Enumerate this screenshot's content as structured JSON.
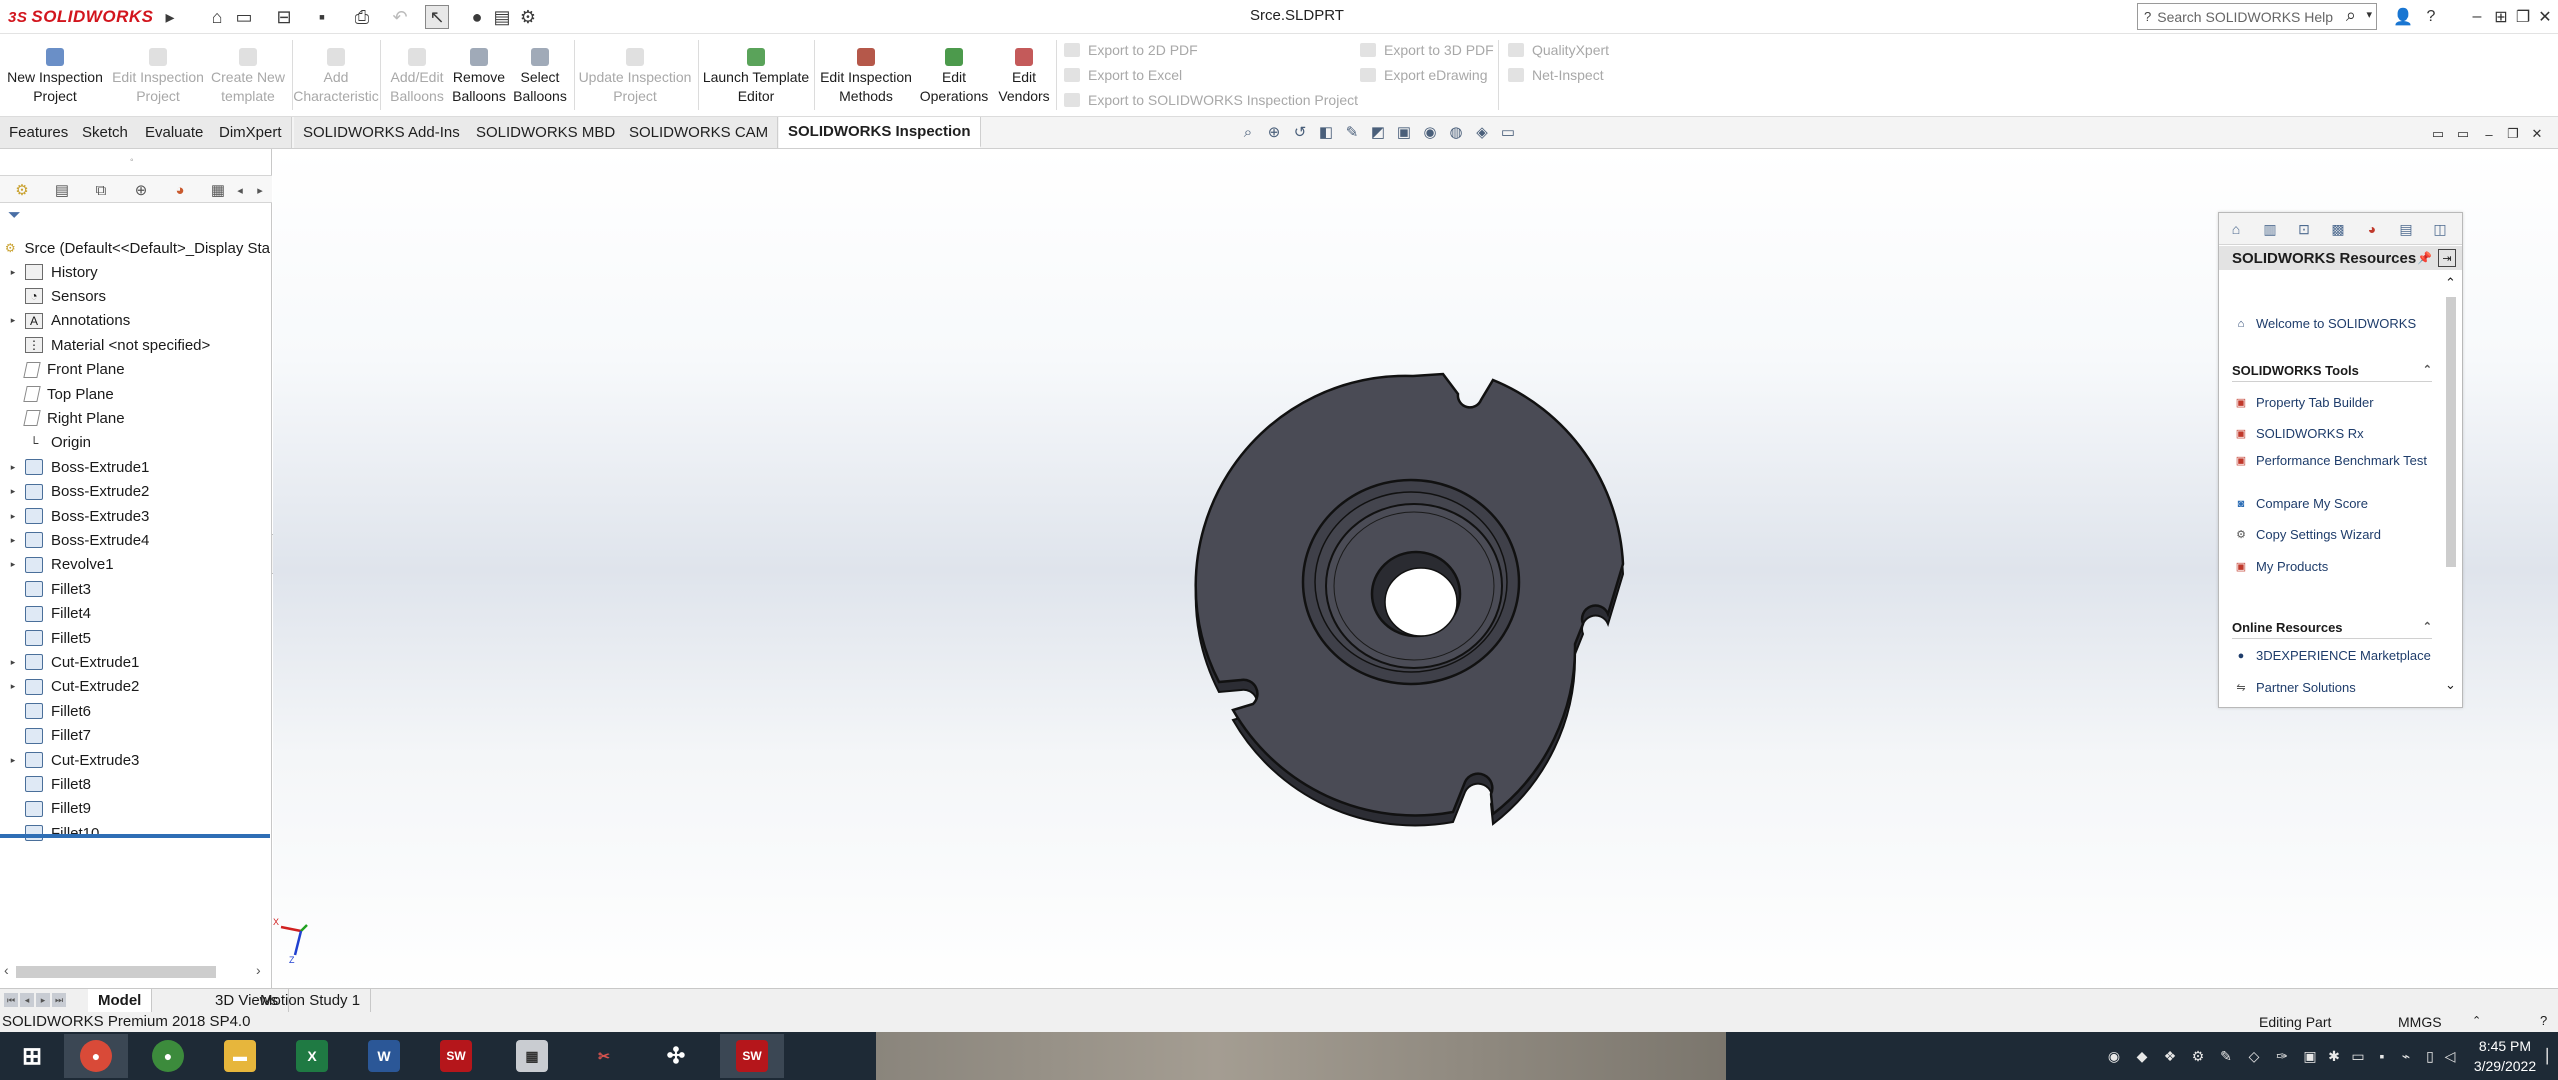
{
  "titlebar": {
    "logo_text": "SOLIDWORKS",
    "logo_prefix": "3S",
    "document_title": "Srce.SLDPRT",
    "search_placeholder": "Search SOLIDWORKS Help"
  },
  "commands": {
    "new_inspection_project": "New Inspection\nProject",
    "edit_inspection_project": "Edit Inspection\nProject",
    "create_new_template": "Create New\ntemplate",
    "add_characteristic": "Add\nCharacteristic",
    "add_edit_balloons": "Add/Edit\nBalloons",
    "remove_balloons": "Remove\nBalloons",
    "select_balloons": "Select\nBalloons",
    "update_inspection_project": "Update Inspection\nProject",
    "launch_template_editor": "Launch Template\nEditor",
    "edit_inspection_methods": "Edit Inspection\nMethods",
    "edit_operations": "Edit\nOperations",
    "edit_vendors": "Edit\nVendors",
    "export_2d_pdf": "Export to 2D PDF",
    "export_excel": "Export to Excel",
    "export_sw_inspection": "Export to SOLIDWORKS Inspection Project",
    "export_3d_pdf": "Export to 3D PDF",
    "export_edrawing": "Export eDrawing",
    "qualityxpert": "QualityXpert",
    "net_inspect": "Net-Inspect"
  },
  "tabs": [
    "Features",
    "Sketch",
    "Evaluate",
    "DimXpert",
    "SOLIDWORKS Add-Ins",
    "SOLIDWORKS MBD",
    "SOLIDWORKS CAM",
    "SOLIDWORKS Inspection"
  ],
  "active_tab": "SOLIDWORKS Inspection",
  "tree": {
    "root": "Srce  (Default<<Default>_Display Sta",
    "items": [
      {
        "label": "History",
        "icon": "folder-icon",
        "expandable": true
      },
      {
        "label": "Sensors",
        "icon": "sensor-icon",
        "expandable": false
      },
      {
        "label": "Annotations",
        "icon": "annotation-icon",
        "expandable": true
      },
      {
        "label": "Material <not specified>",
        "icon": "material-icon",
        "expandable": false
      },
      {
        "label": "Front Plane",
        "icon": "plane-icon",
        "expandable": false
      },
      {
        "label": "Top Plane",
        "icon": "plane-icon",
        "expandable": false
      },
      {
        "label": "Right Plane",
        "icon": "plane-icon",
        "expandable": false
      },
      {
        "label": "Origin",
        "icon": "origin-icon",
        "expandable": false
      },
      {
        "label": "Boss-Extrude1",
        "icon": "extrude-icon",
        "expandable": true
      },
      {
        "label": "Boss-Extrude2",
        "icon": "extrude-icon",
        "expandable": true
      },
      {
        "label": "Boss-Extrude3",
        "icon": "extrude-icon",
        "expandable": true
      },
      {
        "label": "Boss-Extrude4",
        "icon": "extrude-icon",
        "expandable": true
      },
      {
        "label": "Revolve1",
        "icon": "revolve-icon",
        "expandable": true
      },
      {
        "label": "Fillet3",
        "icon": "fillet-icon",
        "expandable": false
      },
      {
        "label": "Fillet4",
        "icon": "fillet-icon",
        "expandable": false
      },
      {
        "label": "Fillet5",
        "icon": "fillet-icon",
        "expandable": false
      },
      {
        "label": "Cut-Extrude1",
        "icon": "cut-extrude-icon",
        "expandable": true
      },
      {
        "label": "Cut-Extrude2",
        "icon": "cut-extrude-icon",
        "expandable": true
      },
      {
        "label": "Fillet6",
        "icon": "fillet-icon",
        "expandable": false
      },
      {
        "label": "Fillet7",
        "icon": "fillet-icon",
        "expandable": false
      },
      {
        "label": "Cut-Extrude3",
        "icon": "cut-extrude-icon",
        "expandable": true
      },
      {
        "label": "Fillet8",
        "icon": "fillet-icon",
        "expandable": false
      },
      {
        "label": "Fillet9",
        "icon": "fillet-icon",
        "expandable": false
      },
      {
        "label": "Fillet10",
        "icon": "fillet-icon",
        "expandable": false
      }
    ]
  },
  "taskpane": {
    "title": "SOLIDWORKS Resources",
    "welcome": "Welcome to SOLIDWORKS",
    "tools_header": "SOLIDWORKS Tools",
    "tools": [
      "Property Tab Builder",
      "SOLIDWORKS Rx",
      "Performance Benchmark Test",
      "Compare My Score",
      "Copy Settings Wizard",
      "My Products"
    ],
    "online_header": "Online Resources",
    "online": [
      "3DEXPERIENCE Marketplace",
      "Partner Solutions"
    ]
  },
  "model_tabs": [
    "Model",
    "3D Views",
    "Motion Study 1"
  ],
  "status": {
    "product": "SOLIDWORKS Premium 2018 SP4.0",
    "mode": "Editing Part",
    "units": "MMGS"
  },
  "clock": {
    "time": "8:45 PM",
    "date": "3/29/2022"
  },
  "colors": {
    "brand_red": "#d2151d",
    "part_body": "#4a4b55",
    "rollback_bar": "#2e6eb5",
    "taskbar": "#1e2a36"
  }
}
